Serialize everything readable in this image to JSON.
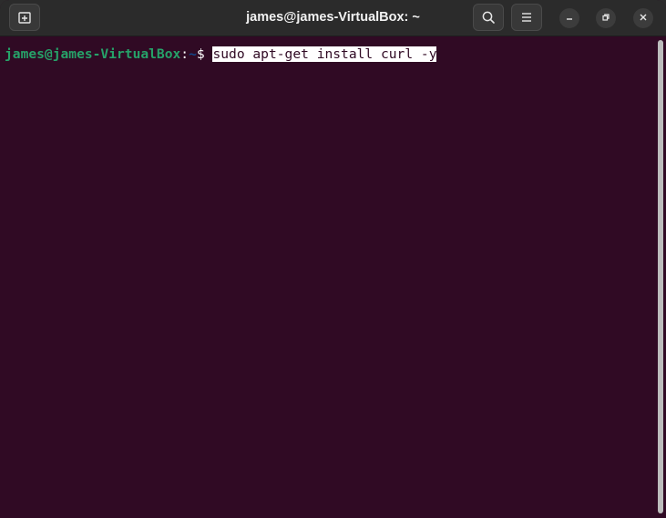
{
  "window": {
    "title": "james@james-VirtualBox: ~"
  },
  "icons": {
    "new_tab": "new-tab-icon",
    "search": "search-icon",
    "menu": "hamburger-menu-icon",
    "minimize": "minimize-icon",
    "restore": "restore-icon",
    "close": "close-icon"
  },
  "terminal": {
    "prompt_user": "james@james-VirtualBox",
    "prompt_colon": ":",
    "prompt_path": "~",
    "prompt_sign": "$ ",
    "command": "sudo apt-get install curl -y"
  },
  "colors": {
    "background": "#300a24",
    "prompt_user": "#26a269",
    "prompt_path": "#12488b",
    "selection_bg": "#ffffff"
  }
}
